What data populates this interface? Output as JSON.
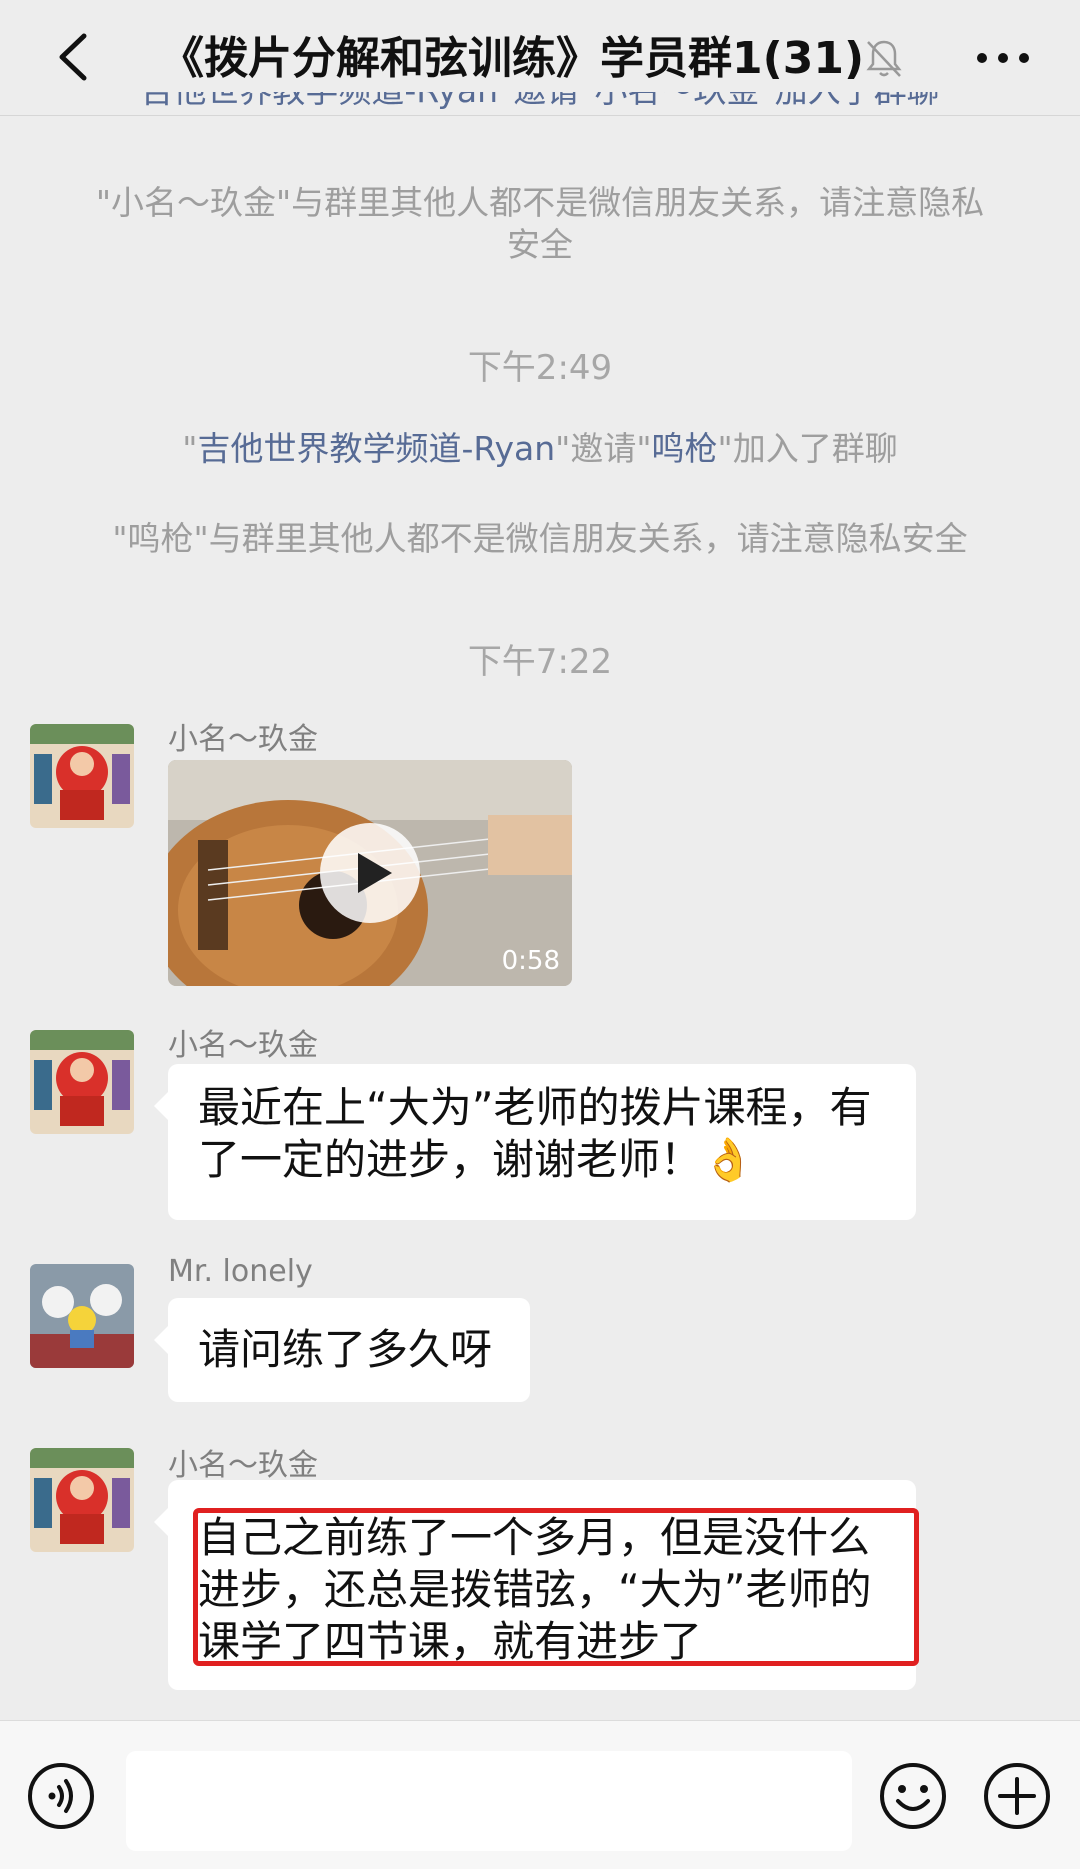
{
  "header": {
    "title": "《拨片分解和弦训练》学员群1(31)"
  },
  "notices": {
    "partial_top": "吉他世界教学频道-Ryan\"邀请\"小名～玖金\"加入了群聊",
    "privacy_1": "\"小名～玖金\"与群里其他人都不是微信朋友关系，请注意隐私安全",
    "time_1": "下午2:49",
    "invite_2": {
      "q1": "\"",
      "inviter": "吉他世界教学频道-Ryan",
      "mid": "\"邀请\"",
      "invitee": "鸣枪",
      "end": "\"加入了群聊"
    },
    "privacy_2": "\"鸣枪\"与群里其他人都不是微信朋友关系，请注意隐私安全",
    "time_2": "下午7:22"
  },
  "messages": [
    {
      "sender": "小名～玖金",
      "type": "video",
      "duration": "0:58"
    },
    {
      "sender": "小名～玖金",
      "type": "text",
      "text": "最近在上“大为”老师的拨片课程，有了一定的进步，谢谢老师！👌"
    },
    {
      "sender": "Mr. lonely",
      "type": "text",
      "text": "请问练了多久呀"
    },
    {
      "sender": "小名～玖金",
      "type": "text",
      "text": "自己之前练了一个多月，但是没什么进步，还总是拨错弦，“大为”老师的课学了四节课，就有进步了"
    }
  ],
  "icons": {
    "back": "chevron-left-icon",
    "mute": "bell-off-icon",
    "more": "more-dots-icon",
    "voice": "voice-icon",
    "emoji": "smiley-icon",
    "plus": "plus-icon",
    "play": "play-icon"
  },
  "colors": {
    "background": "#ededed",
    "link": "#576b95",
    "highlight": "#e02020"
  }
}
